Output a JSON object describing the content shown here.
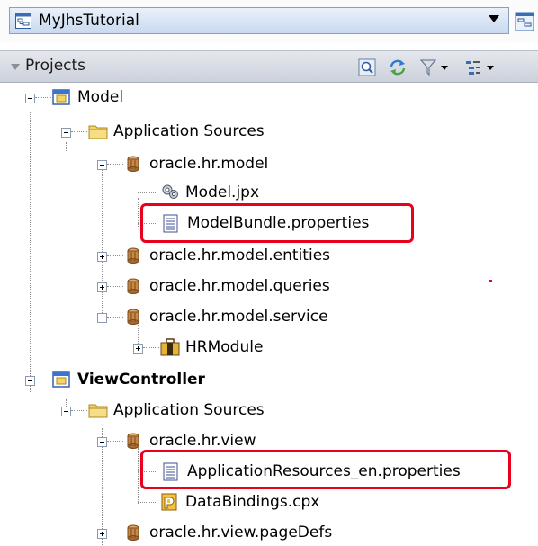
{
  "app_selector": {
    "name": "MyJhsTutorial",
    "icon": "application-icon"
  },
  "projects_panel": {
    "title": "Projects",
    "toolbar": [
      {
        "name": "find-icon"
      },
      {
        "name": "sync-icon"
      },
      {
        "name": "filter-icon"
      },
      {
        "name": "sort-icon"
      }
    ]
  },
  "tree": {
    "model": {
      "label": "Model",
      "app_sources": "Application Sources",
      "pkg_model": "oracle.hr.model",
      "model_jpx": "Model.jpx",
      "model_bundle": "ModelBundle.properties",
      "pkg_entities": "oracle.hr.model.entities",
      "pkg_queries": "oracle.hr.model.queries",
      "pkg_service": "oracle.hr.model.service",
      "hr_module": "HRModule"
    },
    "view_controller": {
      "label": "ViewController",
      "app_sources": "Application Sources",
      "pkg_view": "oracle.hr.view",
      "app_resources": "ApplicationResources_en.properties",
      "data_bindings": "DataBindings.cpx",
      "pkg_pagedefs": "oracle.hr.view.pageDefs"
    }
  },
  "colors": {
    "highlight": "#e8001c",
    "folder": "#f3d46a",
    "package": "#c8884a"
  }
}
